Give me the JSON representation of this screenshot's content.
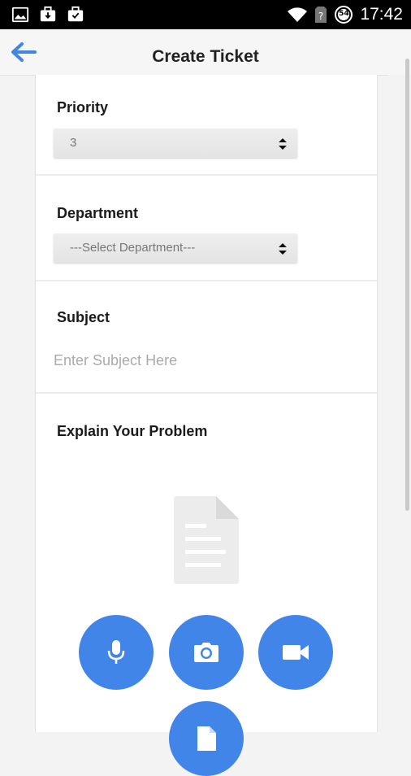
{
  "status_bar": {
    "time": "17:42",
    "icons": [
      "image-icon",
      "briefcase-download-icon",
      "briefcase-check-icon",
      "wifi-icon",
      "no-sim-icon",
      "battery-icon"
    ],
    "battery_level": "54"
  },
  "toolbar": {
    "title": "Create Ticket",
    "back_icon": "arrow-left-icon",
    "accent_color": "#4285e8"
  },
  "form": {
    "priority": {
      "label": "Priority",
      "value": "3"
    },
    "department": {
      "label": "Department",
      "value": "---Select Department---"
    },
    "subject": {
      "label": "Subject",
      "placeholder": "Enter Subject Here"
    },
    "problem": {
      "label": "Explain Your Problem"
    }
  },
  "attachments": {
    "buttons": [
      "microphone-icon",
      "camera-icon",
      "video-camera-icon",
      "document-icon"
    ],
    "button_color": "#4285e8"
  }
}
